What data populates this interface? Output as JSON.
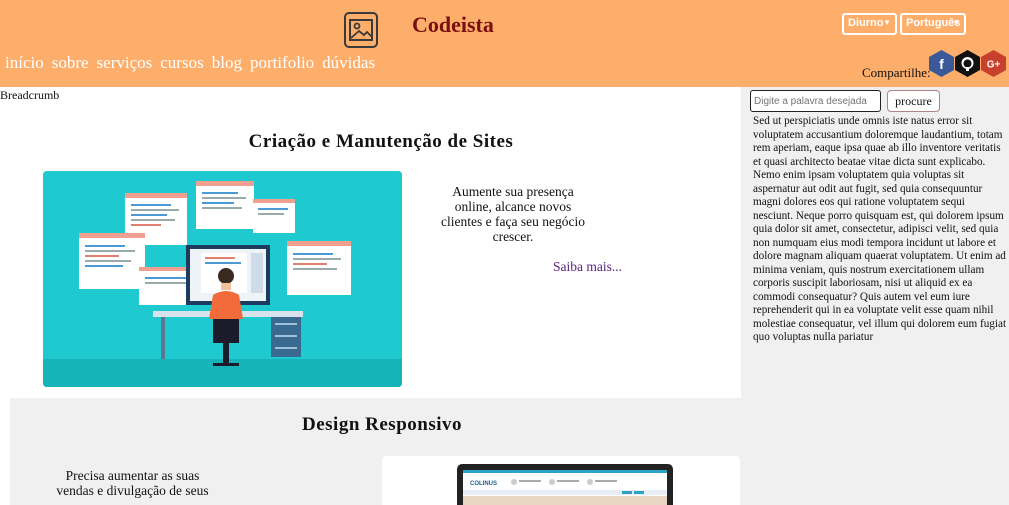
{
  "header": {
    "brand": "Codeista",
    "nav": [
      "início",
      "sobre",
      "serviços",
      "cursos",
      "blog",
      "portifolio",
      "dúvidas"
    ],
    "theme_select": "Diurno",
    "language_select": "Português",
    "share_label": "Compartilhe:",
    "social_icons": [
      "facebook-icon",
      "github-icon",
      "google-plus-icon"
    ]
  },
  "breadcrumb": "Breadcrumb",
  "sidebar": {
    "search_placeholder": "Digite a palavra desejada",
    "search_button": "procure",
    "text": "Sed ut perspiciatis unde omnis iste natus error sit voluptatem accusantium doloremque laudantium, totam rem aperiam, eaque ipsa quae ab illo inventore veritatis et quasi architecto beatae vitae dicta sunt explicabo. Nemo enim ipsam voluptatem quia voluptas sit aspernatur aut odit aut fugit, sed quia consequuntur magni dolores eos qui ratione voluptatem sequi nesciunt. Neque porro quisquam est, qui dolorem ipsum quia dolor sit amet, consectetur, adipisci velit, sed quia non numquam eius modi tempora incidunt ut labore et dolore magnam aliquam quaerat voluptatem. Ut enim ad minima veniam, quis nostrum exercitationem ullam corporis suscipit laboriosam, nisi ut aliquid ex ea commodi consequatur? Quis autem vel eum iure reprehenderit qui in ea voluptate velit esse quam nihil molestiae consequatur, vel illum qui dolorem eum fugiat quo voluptas nulla pariatur"
  },
  "section1": {
    "title": "Criação e Manutenção de Sites",
    "text": "Aumente sua presença online, alcance novos clientes e faça seu negócio crescer.",
    "link": "Saiba mais..."
  },
  "section2": {
    "title": "Design Responsivo",
    "text": "Precisa aumentar as suas vendas e divulgação de seus",
    "mockup_logo": "COLINUS"
  },
  "colors": {
    "header_bg": "#fdae6b",
    "brand": "#7a0e0e",
    "sidebar_bg": "#f0f0f0",
    "link": "#5a2382",
    "hero_bg": "#1ec9cf"
  }
}
